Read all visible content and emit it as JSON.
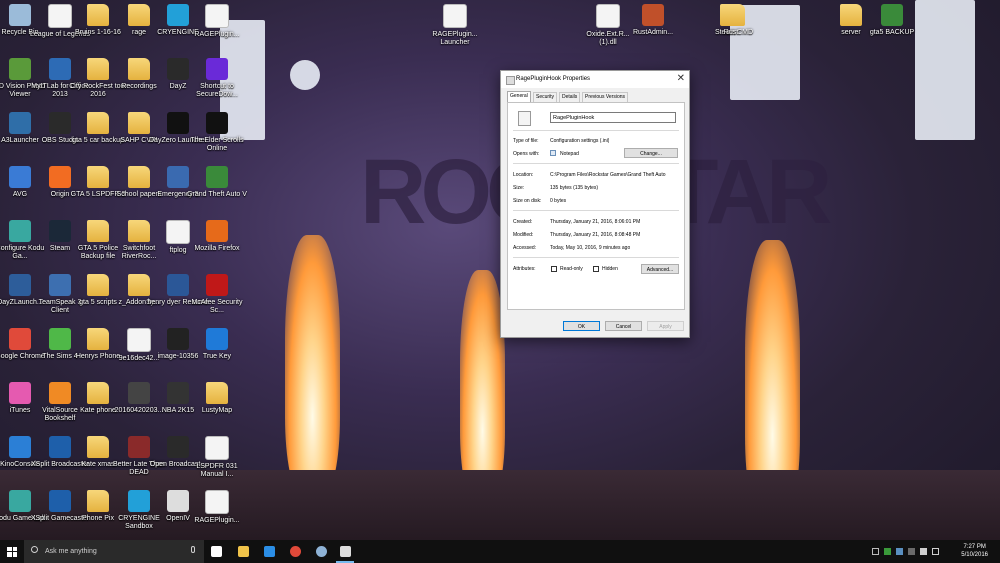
{
  "desktop_icons": [
    {
      "label": "Recycle Bin",
      "icon": "recycle-bin-icon",
      "kind": "app",
      "color": "#9bbbd9"
    },
    {
      "label": "3D Vision Photo Viewer",
      "icon": "3d-vision-icon",
      "kind": "app",
      "color": "#5a9a3a"
    },
    {
      "label": "A3Launcher",
      "icon": "a3launcher-icon",
      "kind": "app",
      "color": "#2f6ea8"
    },
    {
      "label": "AVG",
      "icon": "avg-icon",
      "kind": "app",
      "color": "#3a7bd5"
    },
    {
      "label": "Configure Kodu Ga...",
      "icon": "kodu-icon",
      "kind": "app",
      "color": "#39a8a0"
    },
    {
      "label": "DayZLaunch...",
      "icon": "dayzlauncher-icon",
      "kind": "app",
      "color": "#2d5d9a"
    },
    {
      "label": "Google Chrome",
      "icon": "chrome-icon",
      "kind": "app",
      "color": "#e04a3a"
    },
    {
      "label": "iTunes",
      "icon": "itunes-icon",
      "kind": "app",
      "color": "#e55ab0"
    },
    {
      "label": "KinoConsole",
      "icon": "kinoconsole-icon",
      "kind": "app",
      "color": "#2b7fd6"
    },
    {
      "label": "Kodu Game Lab",
      "icon": "kodu-game-lab-icon",
      "kind": "app",
      "color": "#39a8a0"
    },
    {
      "label": "League of Legends",
      "icon": "file-icon",
      "kind": "file",
      "color": "#f4f4f4"
    },
    {
      "label": "MyITLab for Office 2013",
      "icon": "myitlab-icon",
      "kind": "app",
      "color": "#2d6bb5"
    },
    {
      "label": "OBS Studio",
      "icon": "obs-icon",
      "kind": "app",
      "color": "#2a2a2a"
    },
    {
      "label": "Origin",
      "icon": "origin-icon",
      "kind": "app",
      "color": "#f26c22"
    },
    {
      "label": "Steam",
      "icon": "steam-icon",
      "kind": "app",
      "color": "#1b2838"
    },
    {
      "label": "TeamSpeak 3 Client",
      "icon": "teamspeak-icon",
      "kind": "app",
      "color": "#3d6fb0"
    },
    {
      "label": "The Sims 4",
      "icon": "sims4-icon",
      "kind": "app",
      "color": "#4fb848"
    },
    {
      "label": "VitalSource Bookshelf",
      "icon": "vitalsource-icon",
      "kind": "app",
      "color": "#f08a24"
    },
    {
      "label": "XSplit Broadcaster",
      "icon": "xsplit-icon",
      "kind": "app",
      "color": "#1e5faa"
    },
    {
      "label": "XSplit Gamecaster",
      "icon": "xsplit-gamecaster-icon",
      "kind": "app",
      "color": "#1e5faa"
    },
    {
      "label": "Bruins 1-16-16",
      "icon": "folder-icon",
      "kind": "folder",
      "color": "#e5b23f"
    },
    {
      "label": "City RockFest tour 2016",
      "icon": "folder-icon",
      "kind": "folder",
      "color": "#e5b23f"
    },
    {
      "label": "gta 5 car backup",
      "icon": "folder-icon",
      "kind": "folder",
      "color": "#e5b23f"
    },
    {
      "label": "GTA 5 LSPDFR 3",
      "icon": "folder-icon",
      "kind": "folder",
      "color": "#e5b23f"
    },
    {
      "label": "GTA 5 Police Backup file",
      "icon": "folder-icon",
      "kind": "folder",
      "color": "#e5b23f"
    },
    {
      "label": "gta 5 scripts",
      "icon": "folder-icon",
      "kind": "folder",
      "color": "#e5b23f"
    },
    {
      "label": "Henrys Phone",
      "icon": "folder-icon",
      "kind": "folder",
      "color": "#e5b23f"
    },
    {
      "label": "Kate phone",
      "icon": "folder-icon",
      "kind": "folder",
      "color": "#e5b23f"
    },
    {
      "label": "Kate xmas",
      "icon": "folder-icon",
      "kind": "folder",
      "color": "#e5b23f"
    },
    {
      "label": "Phone Pix",
      "icon": "folder-icon",
      "kind": "folder",
      "color": "#e5b23f"
    },
    {
      "label": "rage",
      "icon": "folder-icon",
      "kind": "folder",
      "color": "#e5b23f"
    },
    {
      "label": "Recordings",
      "icon": "folder-icon",
      "kind": "folder",
      "color": "#e5b23f"
    },
    {
      "label": "SAHP CVPI",
      "icon": "folder-icon",
      "kind": "folder",
      "color": "#e5b23f"
    },
    {
      "label": "School papers",
      "icon": "folder-icon",
      "kind": "folder",
      "color": "#e5b23f"
    },
    {
      "label": "Switchfoot RiverRoc...",
      "icon": "folder-icon",
      "kind": "folder",
      "color": "#e5b23f"
    },
    {
      "label": "z_AddonSy...",
      "icon": "folder-icon",
      "kind": "folder",
      "color": "#e5b23f"
    },
    {
      "label": "9e16dec42...",
      "icon": "image-icon",
      "kind": "file",
      "color": "#f4f4f4"
    },
    {
      "label": "20160420203...",
      "icon": "image-icon",
      "kind": "app",
      "color": "#444444"
    },
    {
      "label": "Better Late Than DEAD",
      "icon": "image-icon",
      "kind": "app",
      "color": "#8a2a2a"
    },
    {
      "label": "CRYENGINE Sandbox",
      "icon": "cryengine-icon",
      "kind": "app",
      "color": "#22a0d8"
    },
    {
      "label": "CRYENGINE",
      "icon": "cryengine-icon",
      "kind": "app",
      "color": "#22a0d8"
    },
    {
      "label": "DayZ",
      "icon": "dayz-icon",
      "kind": "app",
      "color": "#2a2a2a"
    },
    {
      "label": "DayZero Launcher",
      "icon": "dayzero-icon",
      "kind": "app",
      "color": "#111111"
    },
    {
      "label": "Emergency 5",
      "icon": "emergency5-icon",
      "kind": "app",
      "color": "#3a6ab0"
    },
    {
      "label": "ftplog",
      "icon": "file-icon",
      "kind": "file",
      "color": "#f4f4f4"
    },
    {
      "label": "henry dyer Resume",
      "icon": "word-icon",
      "kind": "app",
      "color": "#2b5797"
    },
    {
      "label": "image-10356",
      "icon": "image-icon",
      "kind": "app",
      "color": "#222222"
    },
    {
      "label": "NBA 2K15",
      "icon": "nba2k15-icon",
      "kind": "app",
      "color": "#333333"
    },
    {
      "label": "Open Broadcast...",
      "icon": "obs-icon",
      "kind": "app",
      "color": "#2a2a2a"
    },
    {
      "label": "OpenIV",
      "icon": "openiv-icon",
      "kind": "app",
      "color": "#dddddd"
    },
    {
      "label": "RAGEPlugin...",
      "icon": "file-icon",
      "kind": "file",
      "color": "#f4f4f4"
    },
    {
      "label": "Shortcut to SecureDow...",
      "icon": "shortcut-icon",
      "kind": "app",
      "color": "#6a2ad8"
    },
    {
      "label": "The Elder Scrolls Online",
      "icon": "tes-online-icon",
      "kind": "app",
      "color": "#111111"
    },
    {
      "label": "Grand Theft Auto V",
      "icon": "gta5-icon",
      "kind": "app",
      "color": "#3a8a3a"
    },
    {
      "label": "Mozilla Firefox",
      "icon": "firefox-icon",
      "kind": "app",
      "color": "#e66a1a"
    },
    {
      "label": "McAfee Security Sc...",
      "icon": "mcafee-icon",
      "kind": "app",
      "color": "#c01818"
    },
    {
      "label": "True Key",
      "icon": "true-key-icon",
      "kind": "app",
      "color": "#1f7ad8"
    },
    {
      "label": "LustyMap",
      "icon": "folder-icon",
      "kind": "folder",
      "color": "#e5b23f"
    },
    {
      "label": "LSPDFR 031 Manual I...",
      "icon": "file-icon",
      "kind": "file",
      "color": "#f4f4f4"
    },
    {
      "label": "RAGEPlugin...",
      "icon": "file-icon",
      "kind": "file",
      "color": "#f4f4f4"
    },
    {
      "label": "RAGEPlugin... Launcher",
      "icon": "file-icon",
      "kind": "file",
      "color": "#f4f4f4"
    },
    {
      "label": "Oxide.Ext.R... (1).dll",
      "icon": "dll-icon",
      "kind": "file",
      "color": "#f4f4f4"
    },
    {
      "label": "RustAdmin...",
      "icon": "rustadmin-icon",
      "kind": "app",
      "color": "#c0502a"
    },
    {
      "label": "Steam CMD",
      "icon": "folder-icon",
      "kind": "folder",
      "color": "#e5b23f"
    },
    {
      "label": "Rust",
      "icon": "folder-icon",
      "kind": "folder",
      "color": "#e5b23f"
    },
    {
      "label": "server",
      "icon": "folder-icon",
      "kind": "folder",
      "color": "#e5b23f"
    },
    {
      "label": "gta5 BACKUP",
      "icon": "gta5-icon",
      "kind": "app",
      "color": "#3a8a3a"
    }
  ],
  "background": {
    "sign_text": "ROCKSTAR"
  },
  "dialog": {
    "title": "RagePluginHook Properties",
    "close_glyph": "✕",
    "tabs": [
      "General",
      "Security",
      "Details",
      "Previous Versions"
    ],
    "file_name": "RagePluginHook",
    "type_label": "Type of file:",
    "type_value": "Configuration settings (.ini)",
    "opens_label": "Opens with:",
    "opens_value": "Notepad",
    "change_button": "Change...",
    "location_label": "Location:",
    "location_value": "C:\\Program Files\\Rockstar Games\\Grand Theft Auto",
    "size_label": "Size:",
    "size_value": "135 bytes (135 bytes)",
    "size_disk_label": "Size on disk:",
    "size_disk_value": "0 bytes",
    "created_label": "Created:",
    "created_value": "Thursday, January 21, 2016, 8:06:01 PM",
    "modified_label": "Modified:",
    "modified_value": "Thursday, January 21, 2016, 8:08:48 PM",
    "accessed_label": "Accessed:",
    "accessed_value": "Today, May 10, 2016, 9 minutes ago",
    "attributes_label": "Attributes:",
    "readonly_label": "Read-only",
    "hidden_label": "Hidden",
    "advanced_button": "Advanced...",
    "ok_button": "OK",
    "cancel_button": "Cancel",
    "apply_button": "Apply"
  },
  "taskbar": {
    "search_placeholder": "Ask me anything",
    "apps": [
      {
        "name": "task-view-icon",
        "color": "#ffffff"
      },
      {
        "name": "file-explorer-icon",
        "color": "#f0c34a"
      },
      {
        "name": "edge-icon",
        "color": "#2b8ee6"
      },
      {
        "name": "chrome-icon",
        "color": "#e04a3a"
      },
      {
        "name": "steam-icon",
        "color": "#8fb3d6"
      },
      {
        "name": "notepad-icon",
        "color": "#dddddd"
      }
    ],
    "time": "7:27 PM",
    "date": "5/10/2016"
  }
}
